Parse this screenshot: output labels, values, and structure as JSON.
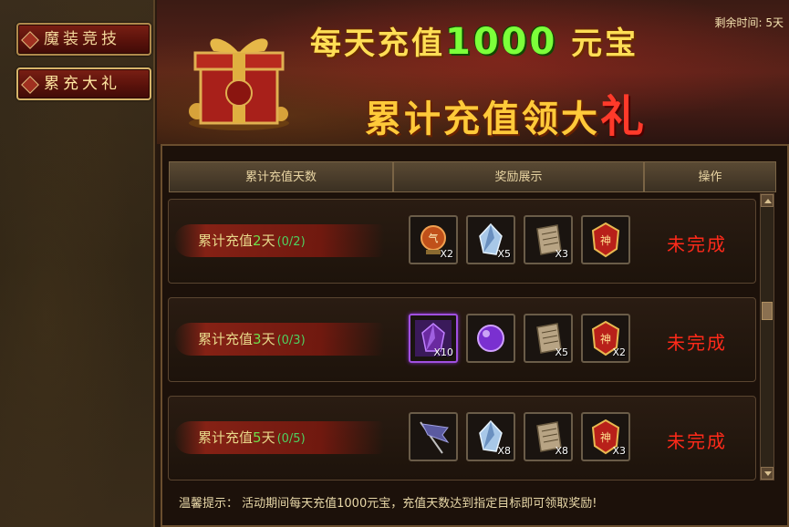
{
  "sidebar": {
    "buttons": [
      {
        "label": "魔装竞技"
      },
      {
        "label": "累充大礼"
      }
    ]
  },
  "banner": {
    "line1_pre": "每天充值",
    "line1_num": "1000",
    "line1_post": " 元宝",
    "line2_pre": "累计充值领大",
    "line2_big": "礼",
    "timer": "剩余时间: 5天"
  },
  "table": {
    "headers": [
      "累计充值天数",
      "奖励展示",
      "操作"
    ]
  },
  "rows": [
    {
      "cond_pre": "累计充值",
      "days": "2",
      "cond_post": "天",
      "progress": "(0/2)",
      "status": "未完成",
      "rewards": [
        {
          "icon": "orb-icon",
          "qty": "X2"
        },
        {
          "icon": "crystal-icon",
          "qty": "X5"
        },
        {
          "icon": "scroll-icon",
          "qty": "X3"
        },
        {
          "icon": "shen-badge-icon",
          "qty": ""
        }
      ]
    },
    {
      "cond_pre": "累计充值",
      "days": "3",
      "cond_post": "天",
      "progress": "(0/3)",
      "status": "未完成",
      "rewards": [
        {
          "icon": "purple-gem-icon",
          "qty": "X10"
        },
        {
          "icon": "purple-orb-icon",
          "qty": ""
        },
        {
          "icon": "scroll-icon",
          "qty": "X5"
        },
        {
          "icon": "shen-badge-icon",
          "qty": "X2"
        }
      ]
    },
    {
      "cond_pre": "累计充值",
      "days": "5",
      "cond_post": "天",
      "progress": "(0/5)",
      "status": "未完成",
      "rewards": [
        {
          "icon": "flag-icon",
          "qty": ""
        },
        {
          "icon": "crystal-icon",
          "qty": "X8"
        },
        {
          "icon": "scroll-icon",
          "qty": "X8"
        },
        {
          "icon": "shen-badge-icon",
          "qty": "X3"
        }
      ]
    }
  ],
  "tip": "温馨提示： 活动期间每天充值1000元宝，充值天数达到指定目标即可领取奖励!"
}
